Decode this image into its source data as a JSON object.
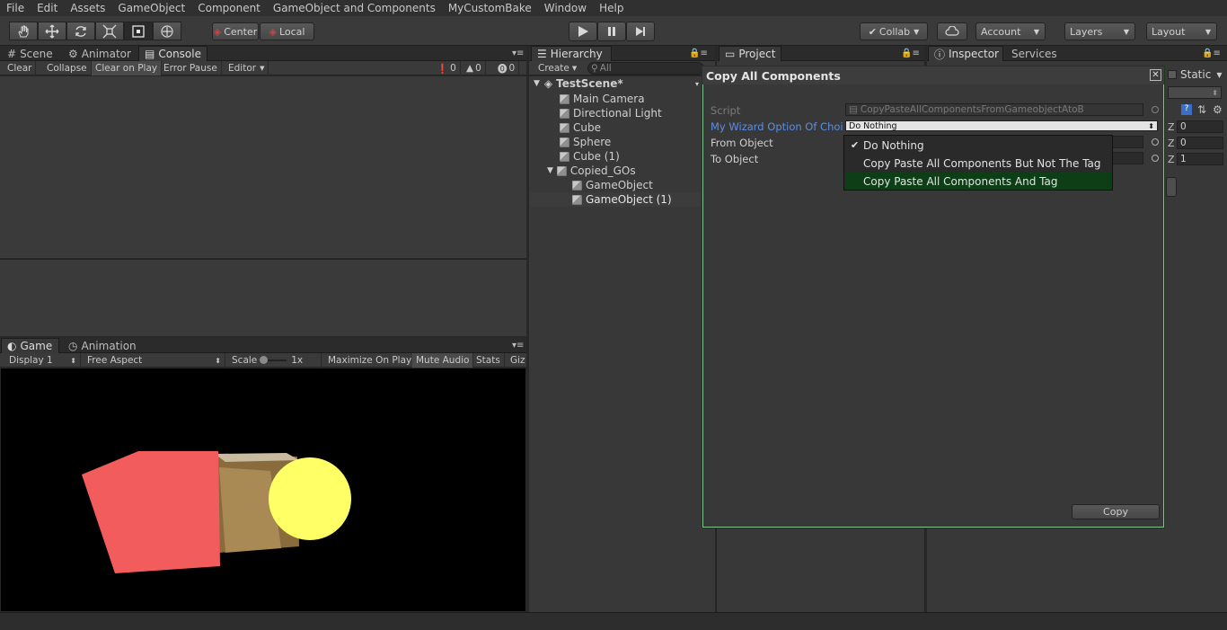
{
  "menu": [
    "File",
    "Edit",
    "Assets",
    "GameObject",
    "Component",
    "GameObject and Components",
    "MyCustomBake",
    "Window",
    "Help"
  ],
  "toolbar": {
    "pivot_label": "Center",
    "space_label": "Local",
    "collab_label": "Collab",
    "account_label": "Account",
    "layers_label": "Layers",
    "layout_label": "Layout"
  },
  "top_left_tabs": {
    "scene": "Scene",
    "animator": "Animator",
    "console": "Console"
  },
  "console_bar": {
    "clear": "Clear",
    "collapse": "Collapse",
    "clear_on_play": "Clear on Play",
    "error_pause": "Error Pause",
    "editor": "Editor",
    "count_log": "0",
    "count_warn": "0",
    "count_error": "0"
  },
  "game_tabs": {
    "game": "Game",
    "animation": "Animation"
  },
  "game_bar": {
    "display": "Display 1",
    "aspect": "Free Aspect",
    "scale": "Scale",
    "scale_value": "1x",
    "maximize": "Maximize On Play",
    "mute": "Mute Audio",
    "stats": "Stats",
    "gizmos": "Giz"
  },
  "hierarchy": {
    "tab": "Hierarchy",
    "create": "Create",
    "search_placeholder": "All",
    "scene": "TestScene*",
    "items": [
      {
        "label": "Main Camera"
      },
      {
        "label": "Directional Light"
      },
      {
        "label": "Cube"
      },
      {
        "label": "Sphere"
      },
      {
        "label": "Cube (1)"
      },
      {
        "label": "Copied_GOs"
      },
      {
        "label": "GameObject"
      },
      {
        "label": "GameObject (1)"
      }
    ]
  },
  "project_tab": "Project",
  "inspector": {
    "tab": "Inspector",
    "services": "Services",
    "static": "Static",
    "z1": "0",
    "z2": "0",
    "z3": "1",
    "z_label": "Z"
  },
  "wizard": {
    "title": "Copy All Components",
    "script_label": "Script",
    "script_value": "CopyPasteAllComponentsFromGameobjectAtoB",
    "option_label": "My Wizard Option Of Choi",
    "option_value": "Do Nothing",
    "from_label": "From Object",
    "to_label": "To Object",
    "copy_button": "Copy"
  },
  "dropdown": {
    "items": [
      "Do Nothing",
      "Copy Paste All Components But Not The Tag",
      "Copy Paste All Components And Tag"
    ],
    "checked": "Do Nothing",
    "highlighted": "Copy Paste All Components And Tag"
  },
  "colors": {
    "highlight": "#0e3e16",
    "option_label": "#5a8ee8",
    "cube_red": "#f25c5c",
    "sphere": "#ffff66"
  }
}
